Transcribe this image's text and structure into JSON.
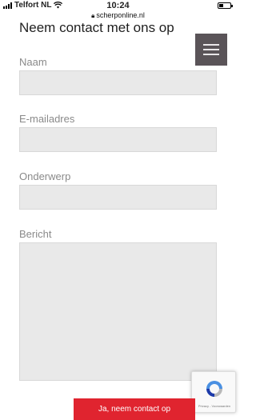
{
  "status_bar": {
    "carrier": "Telfort NL",
    "time": "10:24",
    "url": "scherponline.nl",
    "battery_level": 0.35
  },
  "page": {
    "title": "Neem contact met ons op"
  },
  "menu": {
    "icon": "hamburger-icon",
    "color": "#5a5458"
  },
  "form": {
    "name_label": "Naam",
    "email_label": "E-mailadres",
    "subject_label": "Onderwerp",
    "message_label": "Bericht",
    "name_value": "",
    "email_value": "",
    "subject_value": "",
    "message_value": "",
    "submit_label": "Ja, neem contact op",
    "submit_color": "#e0242f"
  },
  "recaptcha": {
    "icon": "recaptcha-icon",
    "footer": "Privacy - Voorwaarden"
  }
}
